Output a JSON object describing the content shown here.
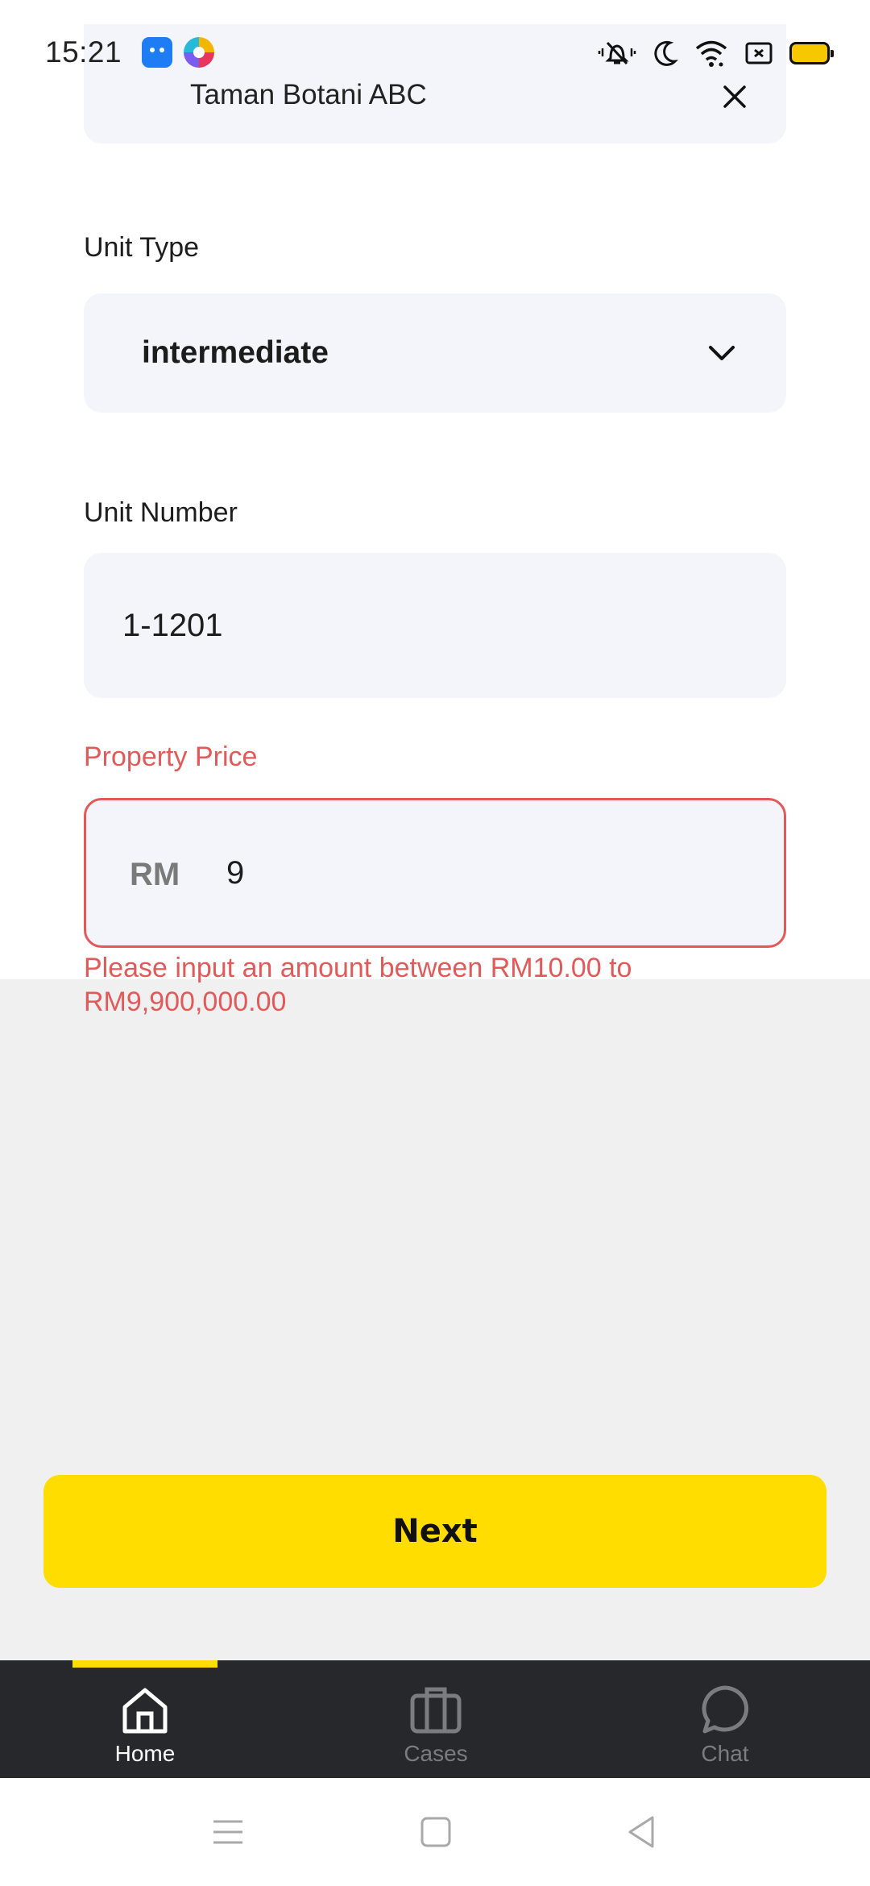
{
  "status_bar": {
    "time": "15:21",
    "icons": [
      "android-app-icon",
      "colorful-app-icon",
      "vibrate-mute-icon",
      "moon-icon",
      "wifi-icon",
      "screen-icon",
      "battery-icon"
    ],
    "battery_color": "#f7c800"
  },
  "form": {
    "location": {
      "value": "Taman Botani ABC",
      "clear_icon": "close-icon"
    },
    "unit_type": {
      "label": "Unit Type",
      "value": "intermediate",
      "icon": "chevron-down-icon"
    },
    "unit_number": {
      "label": "Unit Number",
      "value": "1-1201"
    },
    "property_price": {
      "label": "Property Price",
      "currency": "RM",
      "value": "9",
      "error": "Please input an amount between RM10.00 to RM9,900,000.00",
      "error_color": "#e15a5a"
    }
  },
  "next_button": {
    "label": "Next",
    "color": "#ffdd00"
  },
  "tab_bar": {
    "active": "Home",
    "tabs": [
      {
        "label": "Home",
        "icon": "home-icon"
      },
      {
        "label": "Cases",
        "icon": "briefcase-icon"
      },
      {
        "label": "Chat",
        "icon": "chat-bubble-icon"
      }
    ]
  },
  "system_nav": [
    "menu-icon",
    "square-home-icon",
    "back-triangle-icon"
  ]
}
